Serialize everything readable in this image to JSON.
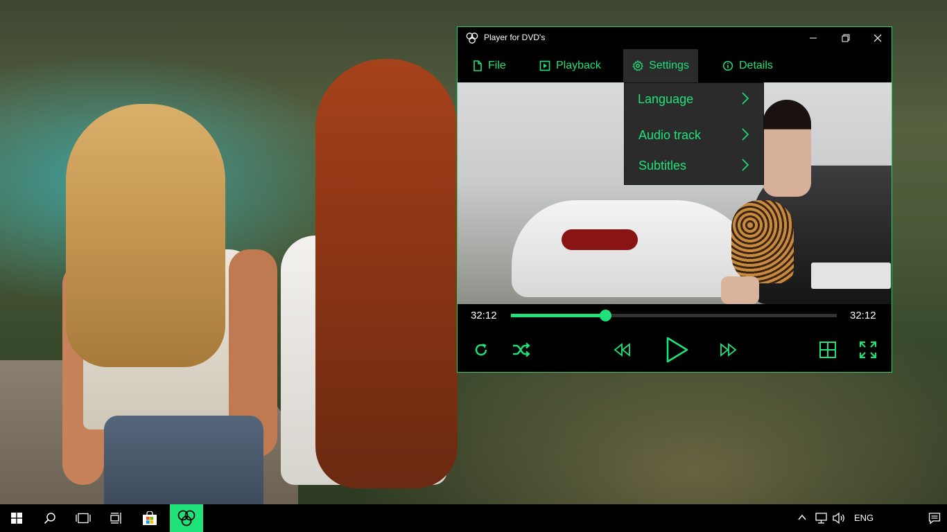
{
  "window": {
    "title": "Player for DVD's",
    "minimize_glyph": "—",
    "maximize_glyph": "❐",
    "close_glyph": "✕"
  },
  "menu": [
    {
      "label": "File",
      "icon": "document-icon"
    },
    {
      "label": "Playback",
      "icon": "play-box-icon"
    },
    {
      "label": "Settings",
      "icon": "gear-icon",
      "active": true
    },
    {
      "label": "Details",
      "icon": "info-icon"
    }
  ],
  "settings_menu": [
    {
      "label": "Language"
    },
    {
      "label": "Audio track"
    },
    {
      "label": "Subtitles"
    }
  ],
  "seek": {
    "current_time": "32:12",
    "total_time": "32:12",
    "progress": 0.29
  },
  "controls": [
    "repeat-icon",
    "shuffle-icon",
    "rewind-icon",
    "play-icon",
    "fast-forward-icon",
    "grid-icon",
    "fullscreen-icon"
  ],
  "taskbar": {
    "language": "ENG"
  },
  "colors": {
    "accent": "#1fe37a",
    "window_bg": "#000000",
    "menu_active_bg": "#2b2b2b"
  }
}
